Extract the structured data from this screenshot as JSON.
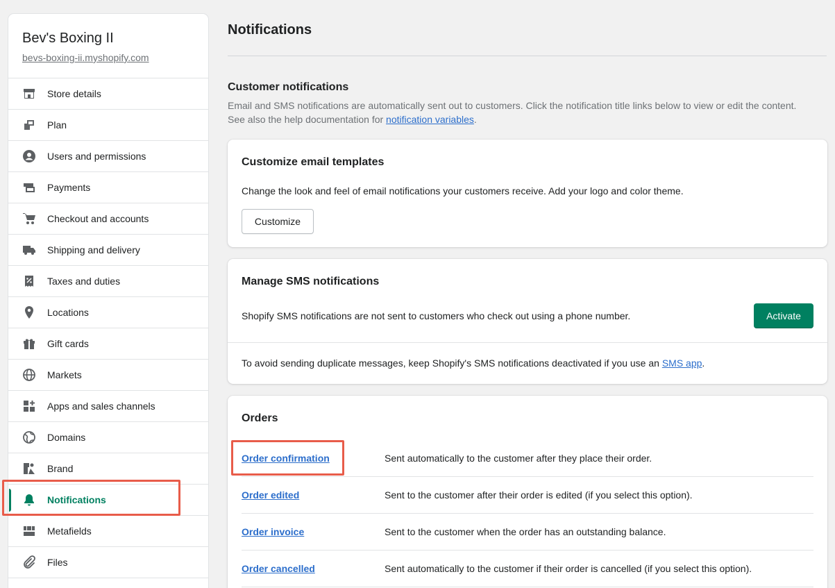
{
  "sidebar": {
    "store_name": "Bev's Boxing II",
    "store_url": "bevs-boxing-ii.myshopify.com",
    "items": [
      {
        "label": "Store details",
        "icon": "store-icon"
      },
      {
        "label": "Plan",
        "icon": "plan-icon"
      },
      {
        "label": "Users and permissions",
        "icon": "user-icon"
      },
      {
        "label": "Payments",
        "icon": "payments-icon"
      },
      {
        "label": "Checkout and accounts",
        "icon": "cart-icon"
      },
      {
        "label": "Shipping and delivery",
        "icon": "truck-icon"
      },
      {
        "label": "Taxes and duties",
        "icon": "tax-icon"
      },
      {
        "label": "Locations",
        "icon": "location-pin-icon"
      },
      {
        "label": "Gift cards",
        "icon": "gift-icon"
      },
      {
        "label": "Markets",
        "icon": "globe-icon"
      },
      {
        "label": "Apps and sales channels",
        "icon": "apps-icon"
      },
      {
        "label": "Domains",
        "icon": "domains-globe-icon"
      },
      {
        "label": "Brand",
        "icon": "brand-icon"
      },
      {
        "label": "Notifications",
        "icon": "bell-icon"
      },
      {
        "label": "Metafields",
        "icon": "metafields-icon"
      },
      {
        "label": "Files",
        "icon": "paperclip-icon"
      }
    ],
    "active_item": "Notifications"
  },
  "main": {
    "page_title": "Notifications",
    "customer_section": {
      "heading": "Customer notifications",
      "desc_before": "Email and SMS notifications are automatically sent out to customers. Click the notification title links below to view or edit the content. See also the help documentation for ",
      "desc_link": "notification variables",
      "desc_after": "."
    },
    "email_card": {
      "title": "Customize email templates",
      "text": "Change the look and feel of email notifications your customers receive. Add your logo and color theme.",
      "button": "Customize"
    },
    "sms_card": {
      "title": "Manage SMS notifications",
      "text": "Shopify SMS notifications are not sent to customers who check out using a phone number.",
      "button": "Activate",
      "footer_before": "To avoid sending duplicate messages, keep Shopify's SMS notifications deactivated if you use an ",
      "footer_link": "SMS app",
      "footer_after": "."
    },
    "orders_card": {
      "title": "Orders",
      "rows": [
        {
          "name": "Order confirmation",
          "desc": "Sent automatically to the customer after they place their order."
        },
        {
          "name": "Order edited",
          "desc": "Sent to the customer after their order is edited (if you select this option)."
        },
        {
          "name": "Order invoice",
          "desc": "Sent to the customer when the order has an outstanding balance."
        },
        {
          "name": "Order cancelled",
          "desc": "Sent automatically to the customer if their order is cancelled (if you select this option)."
        }
      ]
    }
  },
  "colors": {
    "accent_green": "#008060",
    "link_blue": "#2c6ecb",
    "highlight_red": "#e85c4a"
  }
}
